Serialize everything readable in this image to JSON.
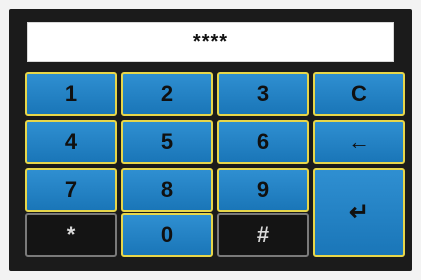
{
  "display": {
    "value": "****"
  },
  "keys": {
    "k1": "1",
    "k2": "2",
    "k3": "3",
    "clear": "C",
    "k4": "4",
    "k5": "5",
    "k6": "6",
    "backspace": "←",
    "k7": "7",
    "k8": "8",
    "k9": "9",
    "enter": "↵",
    "star": "*",
    "k0": "0",
    "hash": "#"
  },
  "colors": {
    "panel": "#1b1b1b",
    "key_blue": "#1f7fc2",
    "key_border": "#e7d64a",
    "key_dark": "#141414",
    "key_dark_border": "#7a7a7a"
  }
}
